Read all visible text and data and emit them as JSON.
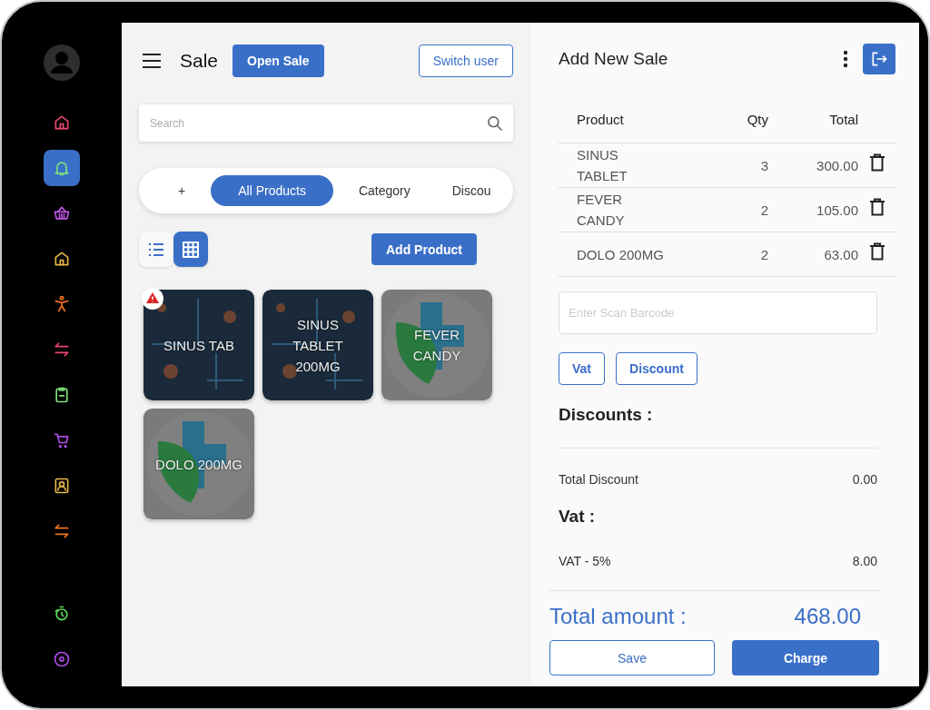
{
  "sidebar": {
    "items": [
      {
        "color": "#e8466e",
        "selected": false
      },
      {
        "color": "#7be07b",
        "selected": true
      },
      {
        "color": "#c257e8",
        "selected": false
      },
      {
        "color": "#e3b54a",
        "selected": false
      },
      {
        "color": "#f07020",
        "selected": false
      },
      {
        "color": "#e8466e",
        "selected": false
      },
      {
        "color": "#7be07b",
        "selected": false
      },
      {
        "color": "#b04de8",
        "selected": false
      },
      {
        "color": "#e3b54a",
        "selected": false
      },
      {
        "color": "#f07020",
        "selected": false
      }
    ],
    "bottom_items": [
      {
        "color": "#5ddc5d",
        "selected": false
      },
      {
        "color": "#b04de8",
        "selected": false
      }
    ]
  },
  "header": {
    "title": "Sale",
    "open_sale": "Open Sale",
    "switch_user": "Switch user"
  },
  "search": {
    "placeholder": "Search"
  },
  "filter_tabs": [
    {
      "label": "+",
      "selected": false
    },
    {
      "label": "All Products",
      "selected": true
    },
    {
      "label": "Category",
      "selected": false
    },
    {
      "label": "Discou",
      "selected": false
    }
  ],
  "view_toggle": [
    {
      "kind": "list",
      "selected": false
    },
    {
      "kind": "grid",
      "selected": true
    }
  ],
  "add_product": "Add Product",
  "products": [
    {
      "name": "SINUS TAB",
      "kind": "photo",
      "warning": true
    },
    {
      "name": "SINUS TABLET 200MG",
      "kind": "photo",
      "warning": false
    },
    {
      "name": "FEVER CANDY",
      "kind": "logo",
      "warning": false
    },
    {
      "name": "DOLO 200MG",
      "kind": "logo",
      "warning": false
    }
  ],
  "sale": {
    "title": "Add New Sale",
    "columns": [
      "Product",
      "Qty",
      "Total"
    ],
    "rows": [
      {
        "product": "SINUS TABLET",
        "qty": "3",
        "total": "300.00"
      },
      {
        "product": "FEVER CANDY",
        "qty": "2",
        "total": "105.00"
      },
      {
        "product": "DOLO 200MG",
        "qty": "2",
        "total": "63.00"
      }
    ],
    "barcode_placeholder": "Enter Scan Barcode",
    "buttons": [
      "Vat",
      "Discount"
    ],
    "discounts_heading": "Discounts :",
    "total_discount": {
      "label": "Total Discount",
      "value": "0.00"
    },
    "vat_heading": "Vat :",
    "vat": {
      "label": "VAT - 5%",
      "value": "8.00"
    },
    "total": {
      "label": "Total amount :",
      "value": "468.00"
    },
    "save": "Save",
    "charge": "Charge"
  }
}
